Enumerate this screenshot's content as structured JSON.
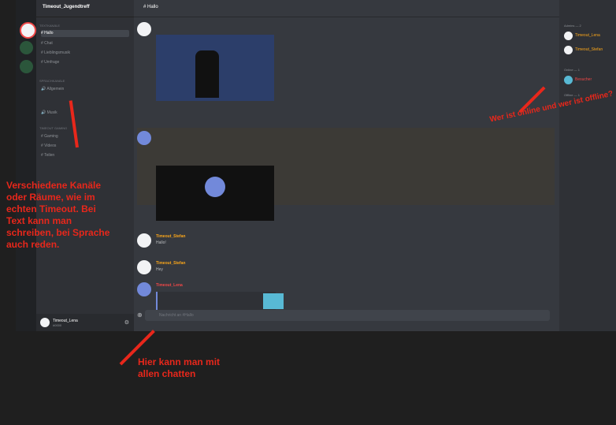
{
  "server": {
    "name": "Timeout_Jugendtreff"
  },
  "channels": {
    "text_category": "Textkanäle",
    "text": [
      {
        "label": "# Hallo",
        "active": true
      },
      {
        "label": "# Chat"
      },
      {
        "label": "# Lieblingsmusik"
      },
      {
        "label": "# Umfrage"
      }
    ],
    "voice_category": "Sprachkanäle",
    "voice": [
      {
        "label": "🔊 Allgemein"
      },
      {
        "label": "🔊 Musik"
      }
    ],
    "games_category": "Timeout Gaming",
    "games": [
      {
        "label": "# Gaming"
      },
      {
        "label": "# Videos"
      },
      {
        "label": "# Teilen"
      }
    ]
  },
  "user_panel": {
    "name": "Timeout_Lena",
    "status": "#0000"
  },
  "topbar": {
    "channel": "# Hallo"
  },
  "messages": [
    {
      "author": "Timeout_Stefan",
      "text": "Hallo!",
      "color": "#faa61a"
    },
    {
      "author": "Timeout_Stefan",
      "text": "Hey",
      "color": "#faa61a"
    },
    {
      "author": "Timeout_Lena",
      "text": "",
      "color": "#f04747"
    }
  ],
  "input": {
    "placeholder": "Nachricht an #Hallo"
  },
  "members": {
    "group1": "Admins — 2",
    "group2": "Online — 1",
    "group3": "Offline — 1",
    "list": [
      {
        "name": "Timeout_Lena",
        "color": "#faa61a"
      },
      {
        "name": "Timeout_Stefan",
        "color": "#faa61a"
      },
      {
        "name": "Besucher",
        "color": "#f04747"
      }
    ]
  },
  "annotations": {
    "left": "Verschiedene Kanäle oder Räume, wie im echten Timeout. Bei Text kann man schreiben, bei Sprache auch reden.",
    "bottom": "Hier kann man mit allen chatten",
    "right": "Wer ist online und wer ist offline?"
  },
  "colors": {
    "annotation": "#e8271b",
    "accent": "#7289da"
  }
}
